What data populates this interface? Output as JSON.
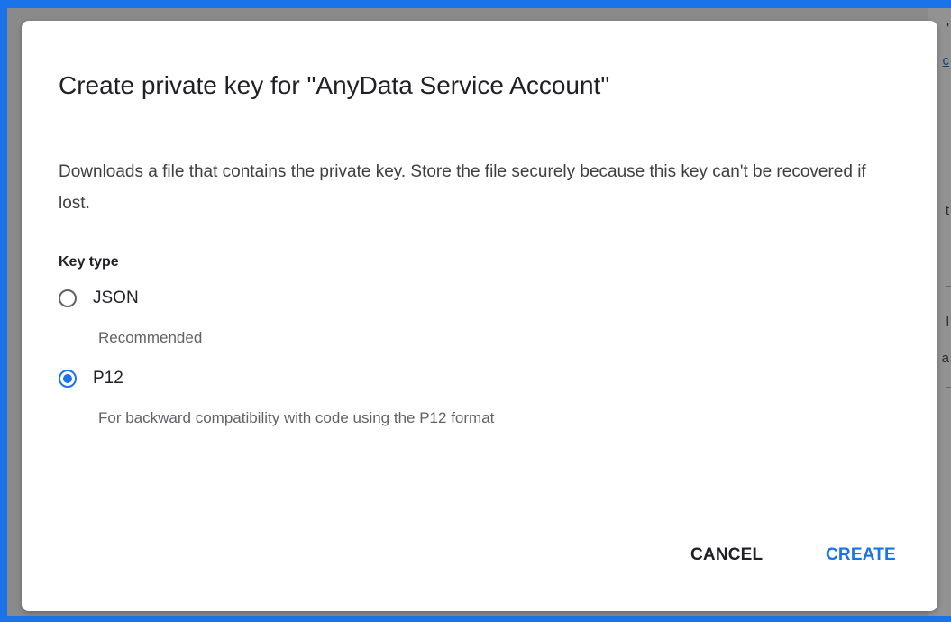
{
  "dialog": {
    "title": "Create private key for \"AnyData Service Account\"",
    "description": "Downloads a file that contains the private key. Store the file securely because this key can't be recovered if lost.",
    "key_type_label": "Key type",
    "options": [
      {
        "label": "JSON",
        "hint": "Recommended",
        "selected": false
      },
      {
        "label": "P12",
        "hint": "For backward compatibility with code using the P12 format",
        "selected": true
      }
    ],
    "cancel_label": "CANCEL",
    "create_label": "CREATE"
  },
  "colors": {
    "accent": "#1a73e8",
    "title_text": "#202124",
    "secondary_text": "#5f6368",
    "window_border": "#1a73e8"
  }
}
